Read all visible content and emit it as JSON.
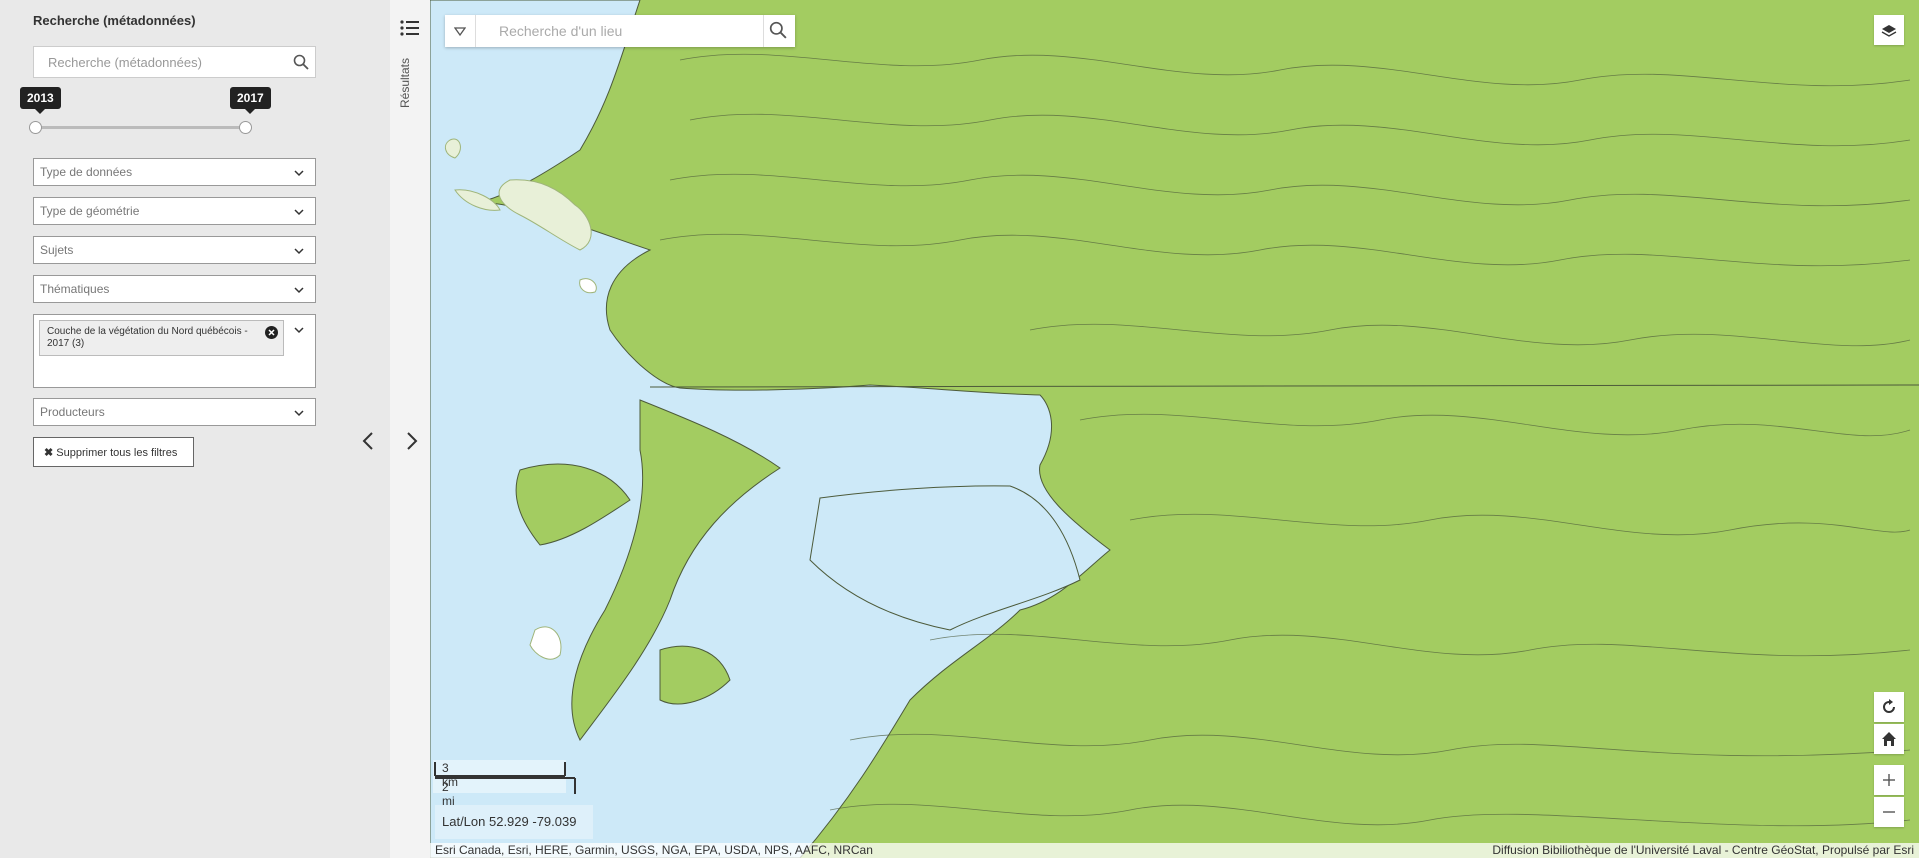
{
  "filters": {
    "search_title": "Recherche (métadonnées)",
    "search_placeholder": "Recherche (métadonnées)",
    "year_range": {
      "min_label": "2013",
      "max_label": "2017"
    },
    "dropdowns": [
      {
        "label": "Type de données"
      },
      {
        "label": "Type de géométrie"
      },
      {
        "label": "Sujets"
      },
      {
        "label": "Thématiques"
      },
      {
        "label": "Producteurs"
      }
    ],
    "selected_tag": {
      "label": "Couche de la végétation du Nord québécois - 2017 (3)"
    },
    "clear_button_label": "Supprimer tous les filtres",
    "clear_icon": "✖"
  },
  "results_tab": {
    "label": "Résultats"
  },
  "map": {
    "place_search_placeholder": "Recherche d'un lieu",
    "scale_km": "3 km",
    "scale_mi": "2 mi",
    "coords": "Lat/Lon 52.929 -79.039",
    "attribution_left": "Esri Canada, Esri, HERE, Garmin, USGS, NGA, EPA, USDA, NPS, AAFC, NRCan",
    "attribution_right": "Diffusion Bibiliothèque de l'Université Laval - Centre GéoStat, Propulsé par Esri",
    "colors": {
      "land": "#a3cc61",
      "water": "#cde9f8",
      "outline": "#4c5a3a",
      "panel": "#e9e9e9"
    }
  }
}
